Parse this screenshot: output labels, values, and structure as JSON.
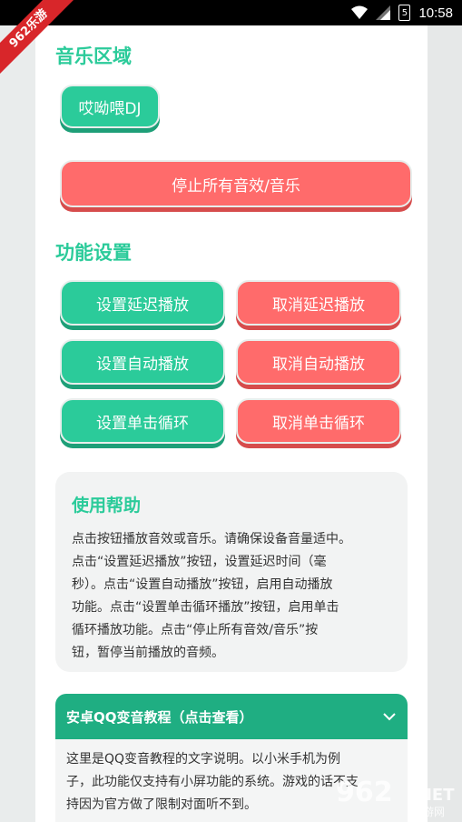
{
  "status_bar": {
    "time": "10:58",
    "battery_level": "5"
  },
  "corner_badge": "962乐游",
  "music_section": {
    "title": "音乐区域",
    "sound_button": "哎呦喂DJ",
    "stop_all_button": "停止所有音效/音乐"
  },
  "settings_section": {
    "title": "功能设置",
    "buttons": [
      {
        "label": "设置延迟播放",
        "color": "#2bcb9a"
      },
      {
        "label": "取消延迟播放",
        "color": "#ff6b6b"
      },
      {
        "label": "设置自动播放",
        "color": "#2bcb9a"
      },
      {
        "label": "取消自动播放",
        "color": "#ff6b6b"
      },
      {
        "label": "设置单击循环",
        "color": "#2bcb9a"
      },
      {
        "label": "取消单击循环",
        "color": "#ff6b6b"
      }
    ]
  },
  "help": {
    "title": "使用帮助",
    "lines": [
      "点击按钮播放音效或音乐。请确保设备音量适中。",
      "点击“设置延迟播放”按钮，设置延迟时间（毫",
      "秒）。点击“设置自动播放”按钮，启用自动播放",
      "功能。点击“设置单击循环播放”按钮，启用单击",
      "循环播放功能。点击“停止所有音效/音乐”按",
      "钮，暂停当前播放的音频。"
    ]
  },
  "tutorial": {
    "title": "安卓QQ变音教程（点击查看）",
    "lines": [
      "这里是QQ变音教程的文字说明。以小米手机为例",
      "子，此功能仅支持有小屏功能的系统。游戏的话不支",
      "持因为官方做了限制对面听不到。"
    ]
  },
  "watermark": {
    "number": "962",
    "net": ".NET",
    "cn": "乐游网"
  },
  "colors": {
    "accent_green": "#2bcb9a",
    "accent_red": "#ff6b6b",
    "header_green": "#1fae82"
  }
}
